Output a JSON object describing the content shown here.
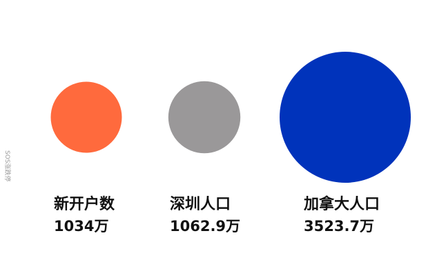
{
  "chart_data": {
    "type": "bubble",
    "items": [
      {
        "label": "新开户数",
        "value": 1034,
        "value_text": "1034万",
        "color": "#FF6A3D"
      },
      {
        "label": "深圳人口",
        "value": 1062.9,
        "value_text": "1062.9万",
        "color": "#9A9899"
      },
      {
        "label": "加拿大人口",
        "value": 3523.7,
        "value_text": "3523.7万",
        "color": "#0033BB"
      }
    ],
    "unit": "万"
  },
  "watermark": {
    "text": "SOS涨跌停"
  }
}
